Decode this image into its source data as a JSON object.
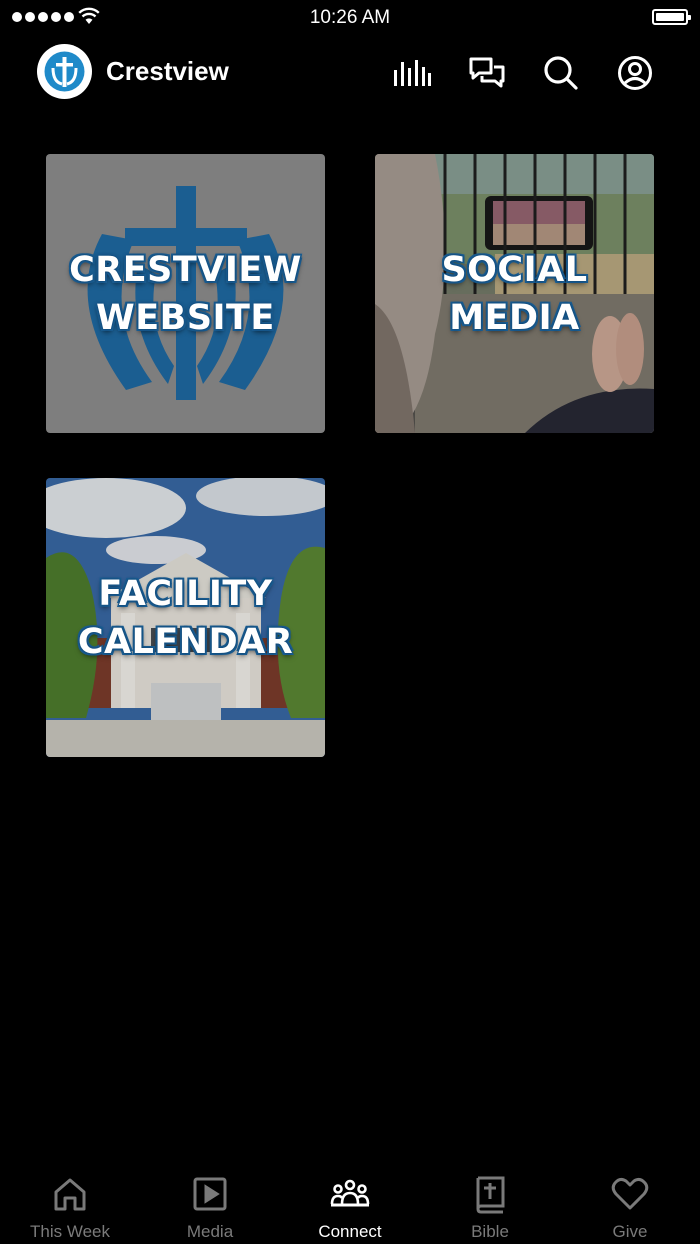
{
  "status_bar": {
    "time": "10:26 AM"
  },
  "header": {
    "title": "Crestview",
    "icons": [
      "live-bars-icon",
      "chat-icon",
      "search-icon",
      "profile-icon"
    ]
  },
  "tiles": [
    {
      "label": "CRESTVIEW\nWEBSITE",
      "image": "crestview-logo"
    },
    {
      "label": "SOCIAL\nMEDIA",
      "image": "phone-on-beach-photo"
    },
    {
      "label": "FACILITY\nCALENDAR",
      "image": "church-building-photo"
    }
  ],
  "tabbar": {
    "tabs": [
      {
        "label": "This Week",
        "icon": "home-icon",
        "active": false
      },
      {
        "label": "Media",
        "icon": "play-icon",
        "active": false
      },
      {
        "label": "Connect",
        "icon": "people-icon",
        "active": true
      },
      {
        "label": "Bible",
        "icon": "bible-icon",
        "active": false
      },
      {
        "label": "Give",
        "icon": "heart-icon",
        "active": false
      }
    ]
  },
  "colors": {
    "background": "#000000",
    "brand_blue": "#1a5d92",
    "inactive_tab": "#7a7a7a"
  }
}
